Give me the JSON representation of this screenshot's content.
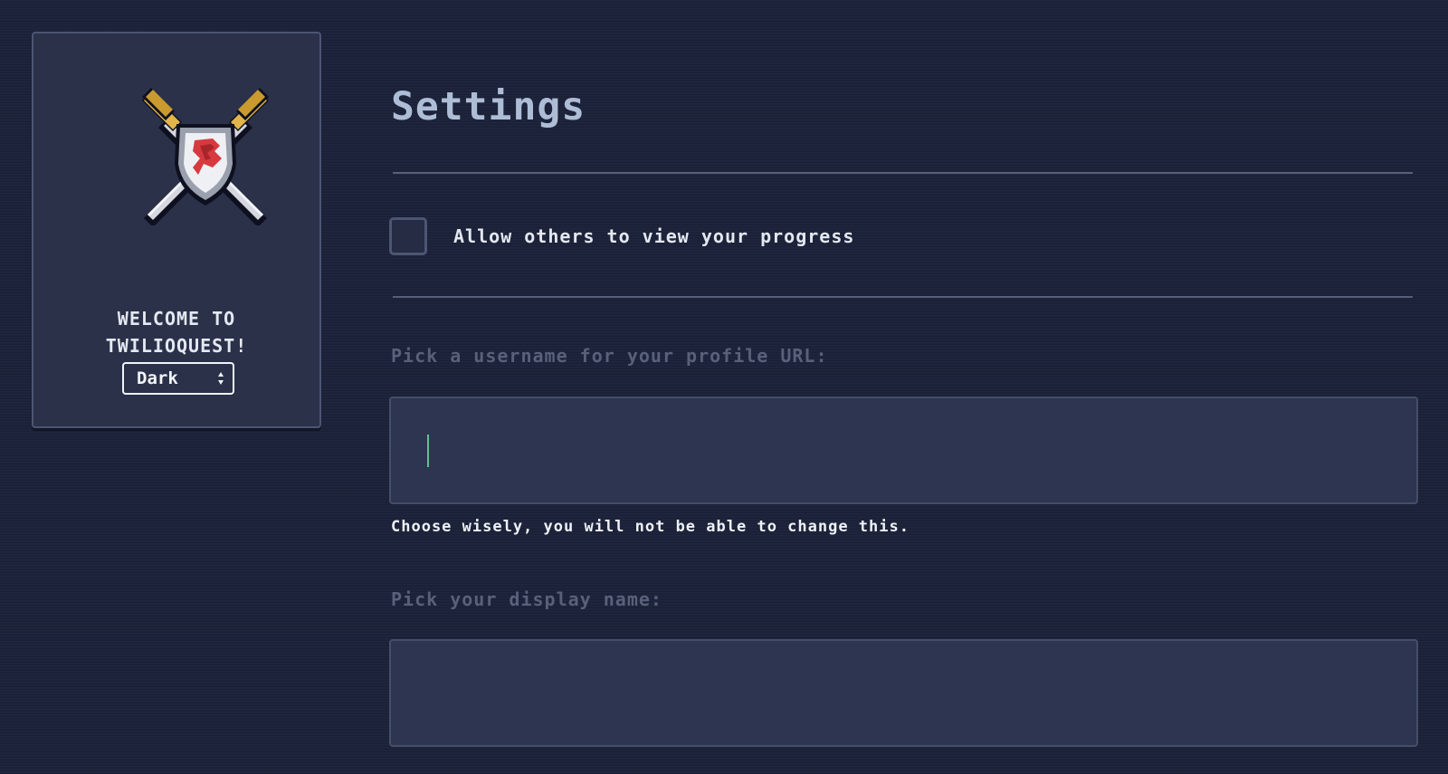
{
  "sidebar": {
    "logo_icon": "crossed-swords-shield-icon",
    "welcome_line1": "WELCOME TO",
    "welcome_line2": "TWILIOQUEST!",
    "theme_select": {
      "selected": "Dark",
      "icon": "up-down-chevron-icon"
    }
  },
  "main": {
    "title": "Settings",
    "progress_checkbox": {
      "label": "Allow others to view your progress",
      "checked": false
    },
    "username": {
      "label": "Pick a username for your profile URL:",
      "value": "",
      "hint": "Choose wisely, you will not be able to change this."
    },
    "display_name": {
      "label": "Pick your display name:",
      "value": ""
    }
  },
  "colors": {
    "background": "#1b2239",
    "card": "#2a3149",
    "title": "#aebdd6",
    "muted_label": "#586179",
    "caret": "#63c08e"
  }
}
